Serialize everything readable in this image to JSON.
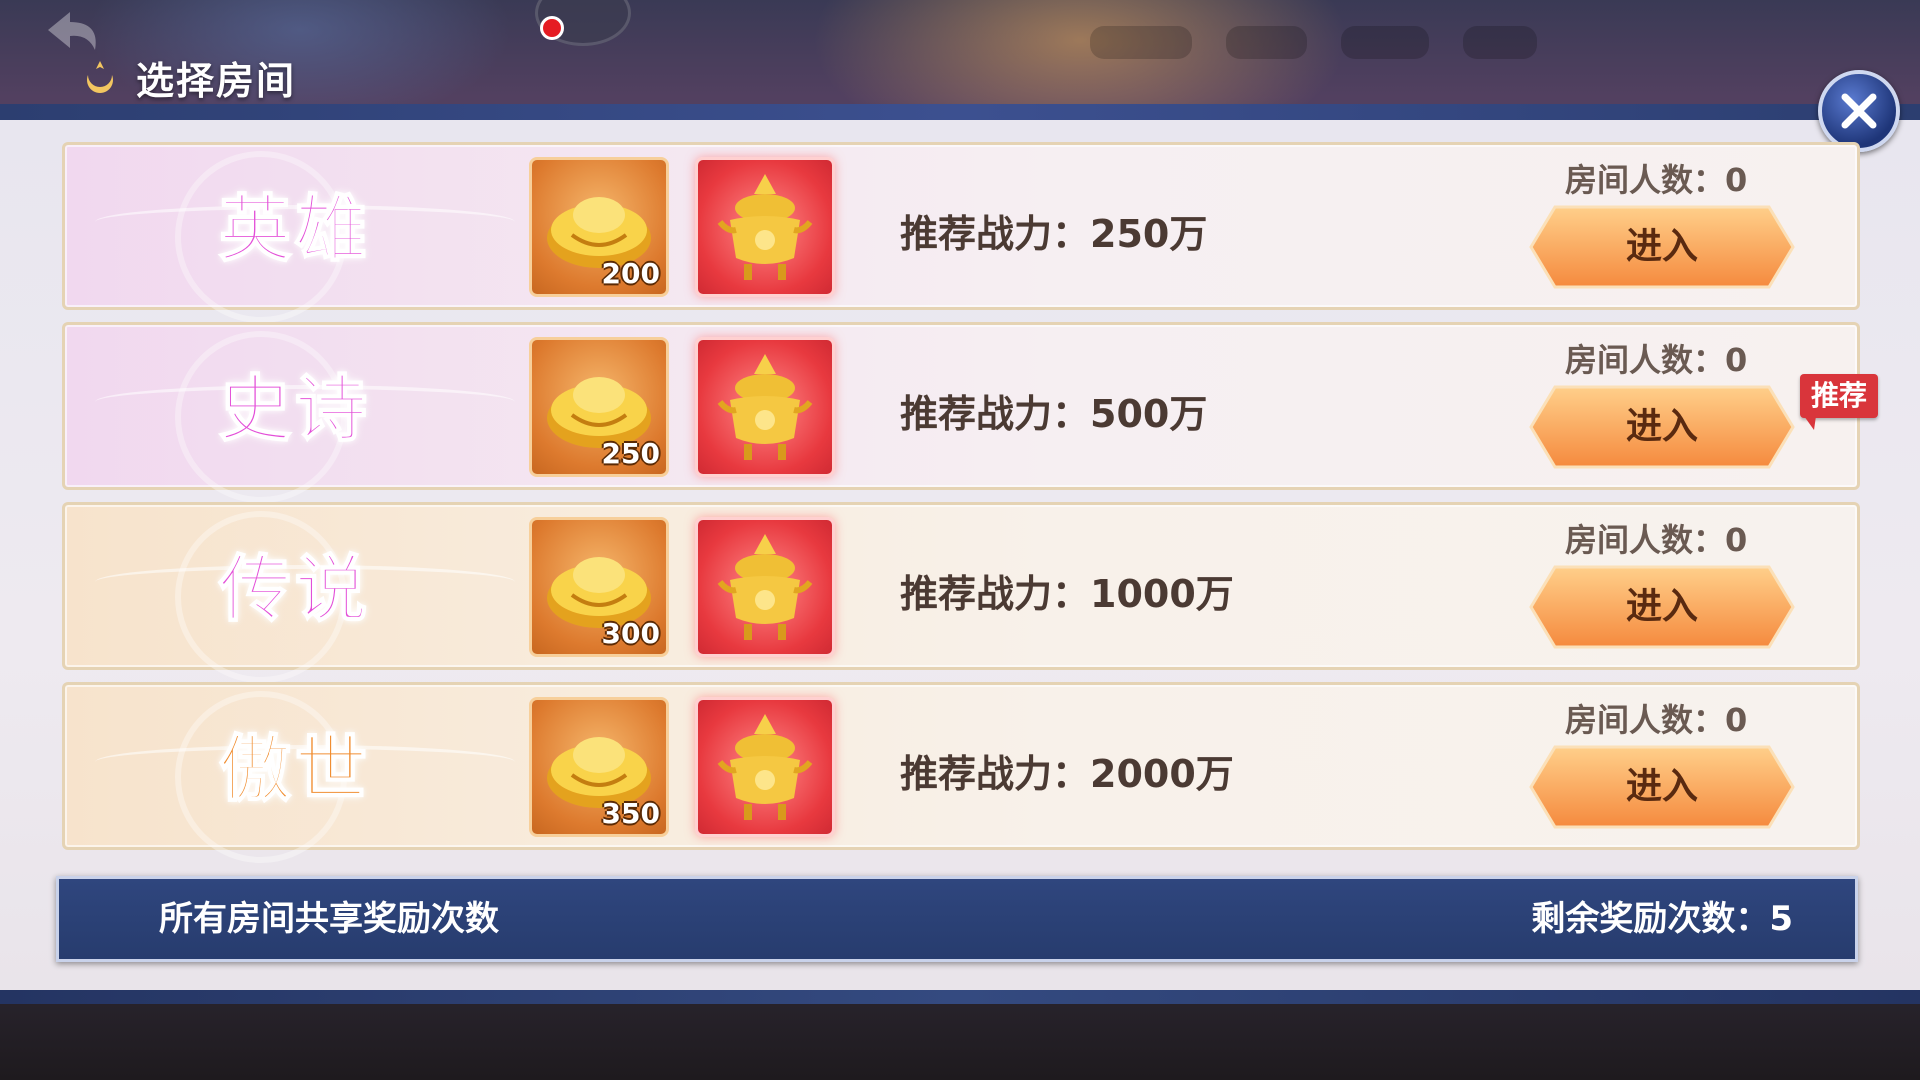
{
  "header": {
    "title": "选择房间"
  },
  "colors": {
    "pink_tier": "#e34fd8",
    "orange_tier": "#f08a2a",
    "enter_button": "#f7a15a",
    "footer": "#2f467e",
    "badge": "#d9353b"
  },
  "rooms": [
    {
      "tier": "英雄",
      "gold_count": "200",
      "power": "推荐战力：250万",
      "members": "房间人数：0",
      "enter_label": "进入"
    },
    {
      "tier": "史诗",
      "gold_count": "250",
      "power": "推荐战力：500万",
      "members": "房间人数：0",
      "enter_label": "进入"
    },
    {
      "tier": "传说",
      "gold_count": "300",
      "power": "推荐战力：1000万",
      "members": "房间人数：0",
      "enter_label": "进入"
    },
    {
      "tier": "傲世",
      "gold_count": "350",
      "power": "推荐战力：2000万",
      "members": "房间人数：0",
      "enter_label": "进入"
    }
  ],
  "recommend_badge": "推荐",
  "footer": {
    "left_text": "所有房间共享奖励次数",
    "right_text": "剩余奖励次数：5"
  },
  "icons": {
    "header": "crescent-icon",
    "gold": "gold-ingot-icon",
    "censer": "golden-censer-icon",
    "close": "close-icon"
  }
}
